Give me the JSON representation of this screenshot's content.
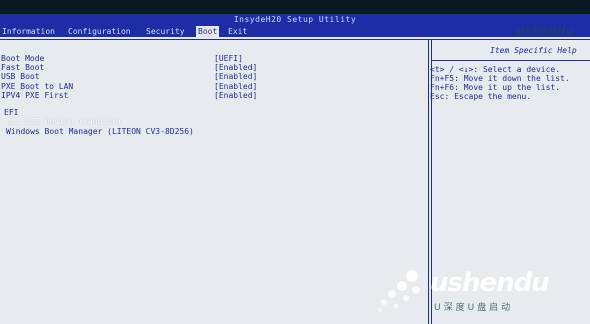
{
  "window_title": "InsydeH20 Setup Utility",
  "menu": [
    {
      "label": "Information",
      "active": false
    },
    {
      "label": "Configuration",
      "active": false
    },
    {
      "label": "Security",
      "active": false
    },
    {
      "label": "Boot",
      "active": true
    },
    {
      "label": "Exit",
      "active": false
    }
  ],
  "settings": [
    {
      "label": "Boot Mode",
      "value": "[UEFI]"
    },
    {
      "label": "Fast Boot",
      "value": "[Enabled]"
    },
    {
      "label": "USB Boot",
      "value": "[Enabled]"
    },
    {
      "label": "PXE Boot to LAN",
      "value": "[Enabled]"
    },
    {
      "label": "IPV4 PXE First",
      "value": "[Enabled]"
    }
  ],
  "efi_header": "EFI",
  "boot_devices": [
    "EFI USB Device (SanDisk)",
    "Windows Boot Manager (LITEON CV3-8D256)"
  ],
  "help": {
    "title": "Item Specific Help",
    "lines": [
      "<t> / <↓>: Select a device.",
      "Fn+F5: Move it down the list.",
      "Fn+F6: Move it up the list.",
      "Esc: Escape the menu."
    ]
  },
  "watermark": {
    "top": "ushendu",
    "main": "ushendu",
    "sub": "U深度U盘启动"
  },
  "colors": {
    "bios_blue": "#1c2da6",
    "background": "#e7ebed"
  }
}
